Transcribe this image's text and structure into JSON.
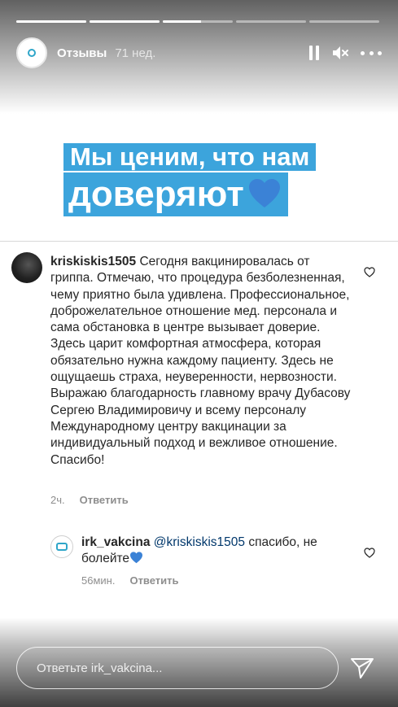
{
  "story": {
    "progress_segments": [
      1,
      1,
      0.55,
      0,
      0
    ],
    "account_name": "Отзывы",
    "time_ago": "71 нед."
  },
  "banner": {
    "line1": "Мы ценим, что нам",
    "line2": "доверяют",
    "heart_color": "#3b82d6",
    "accent_color": "#3ca4dc"
  },
  "comment": {
    "username": "kriskiskis1505",
    "text": "Сегодня вакцинировалась от гриппа. Отмечаю, что процедура безболезненная, чему приятно была удивлена. Профессиональное, доброжелательное отношение мед. персонала и сама обстановка в центре вызывает доверие. Здесь царит комфортная атмосфера, которая обязательно нужна каждому пациенту. Здесь не ощущаешь страха, неуверенности, нервозности. Выражаю благодарность главному врачу Дубасову Сергею Владимировичу и всему персоналу Международному  центру вакцинации за индивидуальный подход и вежливое отношение. Спасибо!",
    "time": "2ч.",
    "reply_label": "Ответить"
  },
  "reply": {
    "username": "irk_vakcina",
    "mention": "@kriskiskis1505",
    "text": "спасибо, не болейте",
    "time": "56мин.",
    "reply_label": "Ответить"
  },
  "input": {
    "placeholder": "Ответьте irk_vakcina..."
  }
}
